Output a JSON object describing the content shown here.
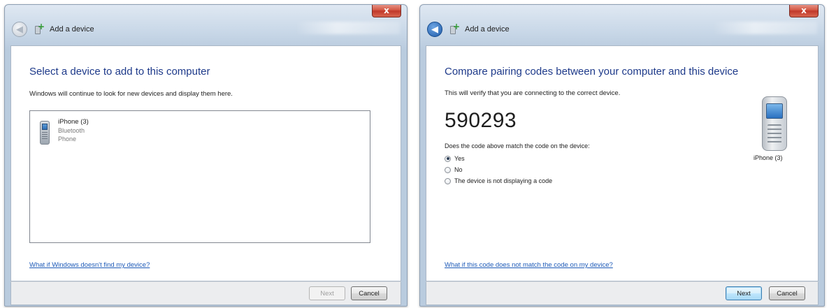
{
  "left_window": {
    "close_label": "x",
    "title": "Add a device",
    "heading": "Select a device to add to this computer",
    "instruction": "Windows will continue to look for new devices and display them here.",
    "devices": [
      {
        "name": "iPhone (3)",
        "connection": "Bluetooth",
        "type": "Phone"
      }
    ],
    "help_link": "What if Windows doesn't find my device?",
    "next_label": "Next",
    "cancel_label": "Cancel"
  },
  "right_window": {
    "close_label": "x",
    "title": "Add a device",
    "heading": "Compare pairing codes between your computer and this device",
    "instruction": "This will verify that you are connecting to the correct device.",
    "pairing_code": "590293",
    "question": "Does the code above match the code on the device:",
    "options": [
      {
        "label": "Yes",
        "selected": true
      },
      {
        "label": "No",
        "selected": false
      },
      {
        "label": "The device is not displaying a code",
        "selected": false
      }
    ],
    "device_label": "iPhone (3)",
    "help_link": "What if this code does not match the code on my device?",
    "next_label": "Next",
    "cancel_label": "Cancel"
  }
}
